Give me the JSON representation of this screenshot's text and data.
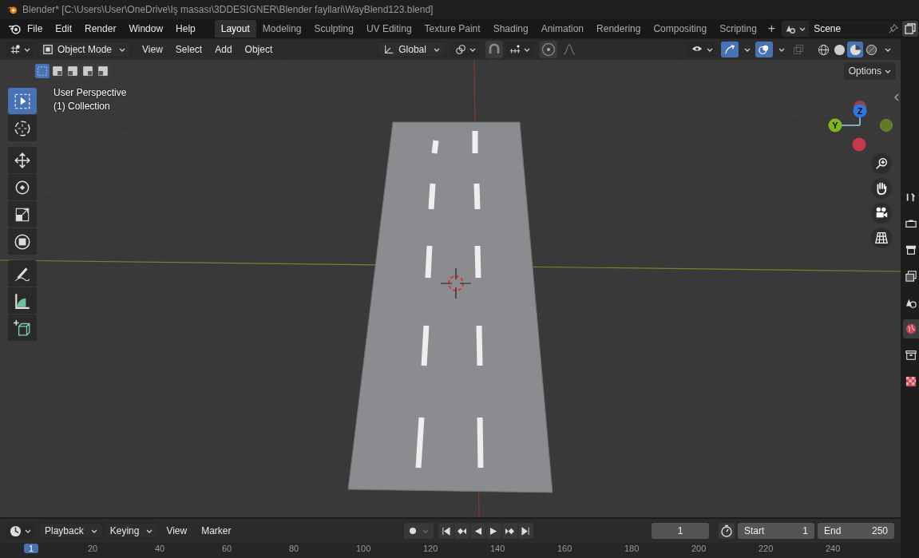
{
  "window": {
    "title": "Blender* [C:\\Users\\User\\OneDrive\\Iş masası\\3DDESIGNER\\Blender fayllari\\WayBlend123.blend]"
  },
  "menus": [
    "File",
    "Edit",
    "Render",
    "Window",
    "Help"
  ],
  "workspaces": [
    {
      "label": "Layout",
      "selected": true
    },
    {
      "label": "Modeling",
      "selected": false
    },
    {
      "label": "Sculpting",
      "selected": false
    },
    {
      "label": "UV Editing",
      "selected": false
    },
    {
      "label": "Texture Paint",
      "selected": false
    },
    {
      "label": "Shading",
      "selected": false
    },
    {
      "label": "Animation",
      "selected": false
    },
    {
      "label": "Rendering",
      "selected": false
    },
    {
      "label": "Compositing",
      "selected": false
    },
    {
      "label": "Scripting",
      "selected": false
    }
  ],
  "add_workspace": "+",
  "scene": "Scene",
  "header": {
    "mode": "Object Mode",
    "menus": [
      "View",
      "Select",
      "Add",
      "Object"
    ],
    "orientation": "Global"
  },
  "selection_modes": [
    {
      "selected": true
    },
    {
      "selected": false
    },
    {
      "selected": false
    },
    {
      "selected": false
    },
    {
      "selected": false
    }
  ],
  "viewport_toggles": [
    {
      "kind": "gizmo",
      "on": true
    },
    {
      "kind": "overlay",
      "on": true
    },
    {
      "kind": "xray",
      "on": false
    }
  ],
  "shading": [
    {
      "kind": "wireframe",
      "selected": false
    },
    {
      "kind": "solid",
      "selected": false
    },
    {
      "kind": "material",
      "selected": true
    },
    {
      "kind": "rendered",
      "selected": false
    }
  ],
  "options": "Options",
  "viewport": {
    "view": "User Perspective",
    "collection": "(1) Collection",
    "gizmo_axes": [
      "Z",
      "Y"
    ]
  },
  "tools": [
    {
      "kind": "select",
      "selected": true
    },
    {
      "kind": "cursor",
      "selected": false
    },
    {
      "kind": "move",
      "selected": false
    },
    {
      "kind": "rotate",
      "selected": false
    },
    {
      "kind": "scale",
      "selected": false
    },
    {
      "kind": "transform",
      "selected": false
    },
    {
      "kind": "annotate",
      "selected": false
    },
    {
      "kind": "measure",
      "selected": false
    },
    {
      "kind": "add-cube",
      "selected": false
    }
  ],
  "properties_tabs": [
    {
      "kind": "tool",
      "selected": false
    },
    {
      "kind": "render",
      "selected": false
    },
    {
      "kind": "output",
      "selected": false
    },
    {
      "kind": "view-layer",
      "selected": false
    },
    {
      "kind": "scene",
      "selected": false
    },
    {
      "kind": "world",
      "selected": true
    },
    {
      "kind": "collection",
      "selected": false
    },
    {
      "kind": "texture",
      "selected": false
    }
  ],
  "timeline": {
    "menus": [
      {
        "label": "Playback",
        "kind": "dropdown"
      },
      {
        "label": "Keying",
        "kind": "dropdown"
      },
      {
        "label": "View",
        "kind": "menu"
      },
      {
        "label": "Marker",
        "kind": "menu"
      }
    ],
    "current_frame": "1",
    "start_label": "Start",
    "start": "1",
    "end_label": "End",
    "end": "250",
    "ruler": [
      {
        "label": "1",
        "selected": true
      },
      {
        "label": "20",
        "selected": false
      },
      {
        "label": "40",
        "selected": false
      },
      {
        "label": "60",
        "selected": false
      },
      {
        "label": "80",
        "selected": false
      },
      {
        "label": "100",
        "selected": false
      },
      {
        "label": "120",
        "selected": false
      },
      {
        "label": "140",
        "selected": false
      },
      {
        "label": "160",
        "selected": false
      },
      {
        "label": "180",
        "selected": false
      },
      {
        "label": "200",
        "selected": false
      },
      {
        "label": "220",
        "selected": false
      },
      {
        "label": "240",
        "selected": false
      }
    ]
  }
}
